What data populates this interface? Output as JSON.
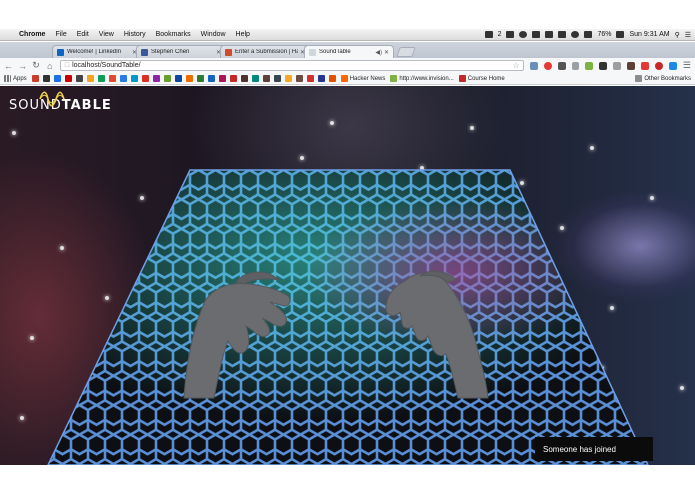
{
  "menubar": {
    "app": "Chrome",
    "items": [
      "File",
      "Edit",
      "View",
      "History",
      "Bookmarks",
      "Window",
      "Help"
    ],
    "battery": "76%",
    "clock": "Sun 9:31 AM",
    "badge": "2"
  },
  "tabs": [
    {
      "label": "Welcome! | LinkedIn",
      "fav_color": "#0a66c2",
      "icon": "linkedin-icon"
    },
    {
      "label": "Stephen Chen",
      "fav_color": "#3b5998",
      "icon": "facebook-icon"
    },
    {
      "label": "Enter a Submission | Hack",
      "fav_color": "#d04a2c",
      "icon": "hackathon-icon"
    },
    {
      "label": "SoundTable",
      "fav_color": "#cfd8dc",
      "icon": "page-icon",
      "active": true
    }
  ],
  "toolbar": {
    "url": "localhost/SoundTable/"
  },
  "bookmarks": {
    "apps_label": "Apps",
    "icon_colors": [
      "#cc3b2b",
      "#333333",
      "#1a73e8",
      "#cc0000",
      "#444444",
      "#f4a51c",
      "#0f9d58",
      "#e04b2e",
      "#2c7be5",
      "#0099cc",
      "#d93025",
      "#8e24aa",
      "#6a9f2e",
      "#0d47a1",
      "#ef6c00",
      "#2e7d32",
      "#1565c0",
      "#ad1457",
      "#c62828",
      "#4e342e",
      "#00897b",
      "#5d4037",
      "#37474f",
      "#f9a825",
      "#6d4c41",
      "#d32f2f",
      "#283593",
      "#e65100"
    ],
    "labeled": [
      {
        "label": "Hacker News",
        "color": "#ff6600",
        "icon": "hacker-news-icon"
      },
      {
        "label": "http://www.invision...",
        "color": "#7cb342",
        "icon": "invision-icon"
      },
      {
        "label": "Course Home",
        "color": "#c62828",
        "icon": "course-home-icon"
      }
    ],
    "other_label": "Other Bookmarks"
  },
  "page": {
    "logo_plain": "SOUND",
    "logo_bold": "TABLE",
    "toast": "Someone has joined",
    "colors": {
      "hex_stroke": "#5a8fd6",
      "hex_glow": "#3fe0d0",
      "hand": "#6a6c70"
    }
  }
}
